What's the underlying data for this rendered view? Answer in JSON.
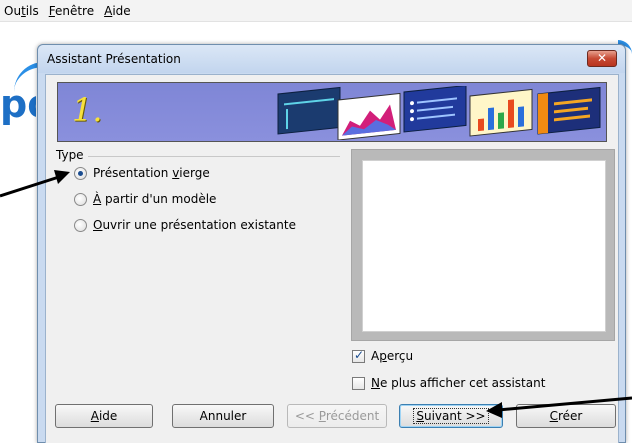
{
  "menubar": {
    "items": [
      {
        "before": "Ou",
        "mnemonic": "t",
        "after": "ils"
      },
      {
        "before": "",
        "mnemonic": "F",
        "after": "enêtre"
      },
      {
        "before": "",
        "mnemonic": "A",
        "after": "ide"
      }
    ]
  },
  "dialog": {
    "title": "Assistant Présentation",
    "close_glyph": "✕",
    "step_number": "1.",
    "type_group": {
      "label": "Type",
      "options": [
        {
          "before": "Présentation ",
          "mnemonic": "v",
          "after": "ierge",
          "checked": true
        },
        {
          "before": "",
          "mnemonic": "À",
          "after": " partir d'un modèle",
          "checked": false
        },
        {
          "before": "",
          "mnemonic": "O",
          "after": "uvrir une présentation existante",
          "checked": false
        }
      ]
    },
    "preview_checkbox": {
      "before": "A",
      "mnemonic": "p",
      "after": "erçu",
      "checked": true
    },
    "no_show_checkbox": {
      "before": "",
      "mnemonic": "N",
      "after": "e plus afficher cet assistant",
      "checked": false
    },
    "buttons": {
      "help": {
        "before": "",
        "mnemonic": "A",
        "after": "ide"
      },
      "cancel": "Annuler",
      "previous": {
        "before": "<< ",
        "mnemonic": "P",
        "after": "récédent"
      },
      "next": {
        "before": "",
        "mnemonic": "S",
        "after": "uivant >>"
      },
      "create": {
        "before": "",
        "mnemonic": "C",
        "after": "réer"
      }
    }
  },
  "colors": {
    "banner": "#848bd9",
    "step_number": "#f7e13c",
    "dialog_frame": "#c9daf0",
    "close_button": "#c74a34"
  }
}
